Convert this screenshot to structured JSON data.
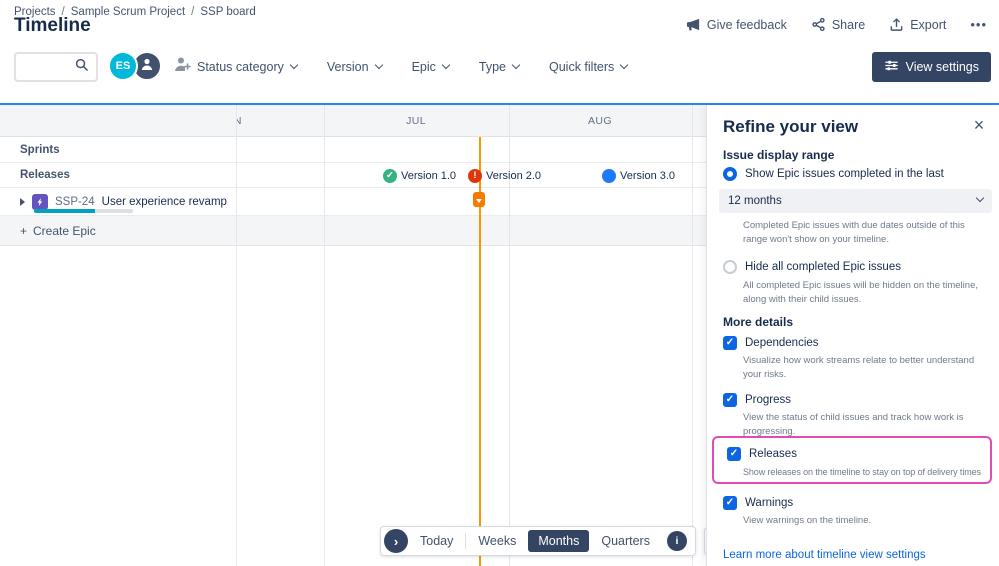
{
  "breadcrumb": {
    "items": [
      "Projects",
      "Sample Scrum Project",
      "SSP board"
    ],
    "separator": "/"
  },
  "page": {
    "title": "Timeline"
  },
  "header_actions": {
    "give_feedback": "Give feedback",
    "share": "Share",
    "export": "Export",
    "more_icon": "•••"
  },
  "toolbar": {
    "avatar_initials": "ES",
    "filters": [
      {
        "label": "Status category"
      },
      {
        "label": "Version"
      },
      {
        "label": "Epic"
      },
      {
        "label": "Type"
      },
      {
        "label": "Quick filters"
      }
    ],
    "view_settings_label": "View settings"
  },
  "timeline": {
    "months": [
      {
        "label": "JUN"
      },
      {
        "label": "JUL"
      },
      {
        "label": "AUG"
      }
    ],
    "sections": {
      "sprints": "Sprints",
      "releases": "Releases"
    },
    "release_markers": [
      {
        "label": "Version 1.0",
        "status": "released"
      },
      {
        "label": "Version 2.0",
        "status": "overdue"
      },
      {
        "label": "Version 3.0",
        "status": "unreleased"
      }
    ],
    "epic": {
      "key": "SSP-24",
      "summary": "User experience revamp",
      "progress_percent": 62
    },
    "create_epic_label": "Create Epic",
    "controls": {
      "today": "Today",
      "weeks": "Weeks",
      "months": "Months",
      "quarters": "Quarters",
      "selected_zoom": "Months"
    }
  },
  "panel": {
    "title": "Refine your view",
    "issue_display_range": {
      "heading": "Issue display range",
      "show_completed": {
        "label": "Show Epic issues completed in the last",
        "selected": true,
        "select_value": "12 months",
        "help": "Completed Epic issues with due dates outside of this range won't show on your timeline."
      },
      "hide_completed": {
        "label": "Hide all completed Epic issues",
        "selected": false,
        "help": "All completed Epic issues will be hidden on the timeline, along with their child issues."
      }
    },
    "more_details": {
      "heading": "More details",
      "options": [
        {
          "label": "Dependencies",
          "checked": true,
          "help": "Visualize how work streams relate to better understand your risks."
        },
        {
          "label": "Progress",
          "checked": true,
          "help": "View the status of child issues and track how work is progressing."
        },
        {
          "label": "Releases",
          "checked": true,
          "highlighted": true,
          "help": "Show releases on the timeline to stay on top of delivery times"
        },
        {
          "label": "Warnings",
          "checked": true,
          "help": "View warnings on the timeline."
        }
      ]
    },
    "footer_link": "Learn more about timeline view settings"
  },
  "icons": {
    "plus": "+",
    "close": "×",
    "check": "✓",
    "exclamation": "!",
    "chevron_right": "›",
    "info": "i"
  },
  "colors": {
    "accent_blue": "#2684FF",
    "today_line": "#FB9700",
    "highlight_pink": "#E24BB5",
    "epic_purple": "#6554C0",
    "released_green": "#36B37E",
    "overdue_red": "#DE350B",
    "unreleased_blue": "#1D7AFC",
    "avatar_teal": "#00B8D9",
    "dark_button": "#344563"
  }
}
